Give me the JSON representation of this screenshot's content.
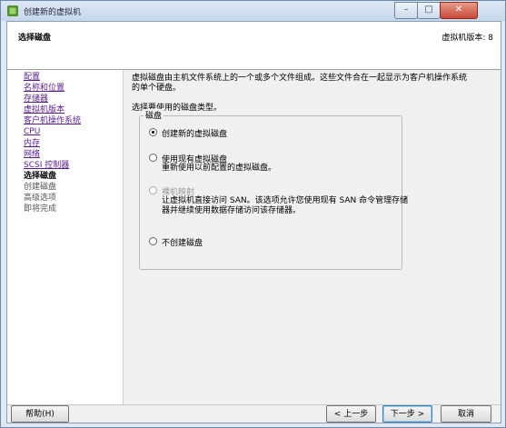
{
  "window": {
    "title": "创建新的虚拟机",
    "controls": [
      "–",
      "□",
      "✕"
    ]
  },
  "header": {
    "title": "选择磁盘",
    "version": "虚拟机版本: 8"
  },
  "sidebar": {
    "items": [
      {
        "label": "配置",
        "state": "link"
      },
      {
        "label": "名称和位置",
        "state": "link"
      },
      {
        "label": "存储器",
        "state": "link"
      },
      {
        "label": "虚拟机版本",
        "state": "link"
      },
      {
        "label": "客户机操作系统",
        "state": "link"
      },
      {
        "label": "CPU",
        "state": "link"
      },
      {
        "label": "内存",
        "state": "link"
      },
      {
        "label": "网络",
        "state": "link"
      },
      {
        "label": "SCSI 控制器",
        "state": "link"
      },
      {
        "label": "选择磁盘",
        "state": "current"
      },
      {
        "label": "创建磁盘",
        "state": "pending"
      },
      {
        "label": "高级选项",
        "state": "pending"
      },
      {
        "label": "即将完成",
        "state": "pending"
      }
    ]
  },
  "main": {
    "description_line1": "虚拟磁盘由主机文件系统上的一个或多个文件组成。这些文件合在一起显示为客户机操作系统",
    "description_line2": "的单个硬盘。",
    "instruction": "选择要使用的磁盘类型。",
    "group_label": "磁盘",
    "options": [
      {
        "label": "创建新的虚拟磁盘",
        "checked": true,
        "enabled": true,
        "sub": []
      },
      {
        "label": "使用现有虚拟磁盘",
        "checked": false,
        "enabled": true,
        "sub": [
          "重新使用以前配置的虚拟磁盘。"
        ]
      },
      {
        "label": "裸机映射",
        "checked": false,
        "enabled": false,
        "sub": [
          "让虚拟机直接访问 SAN。该选项允许您使用现有 SAN 命令管理存储",
          "器并继续使用数据存储访问该存储器。"
        ]
      },
      {
        "label": "不创建磁盘",
        "checked": false,
        "enabled": true,
        "sub": []
      }
    ]
  },
  "footer": {
    "help": "帮助(H)",
    "back": "< 上一步",
    "next": "下一步 >",
    "cancel": "取消"
  }
}
